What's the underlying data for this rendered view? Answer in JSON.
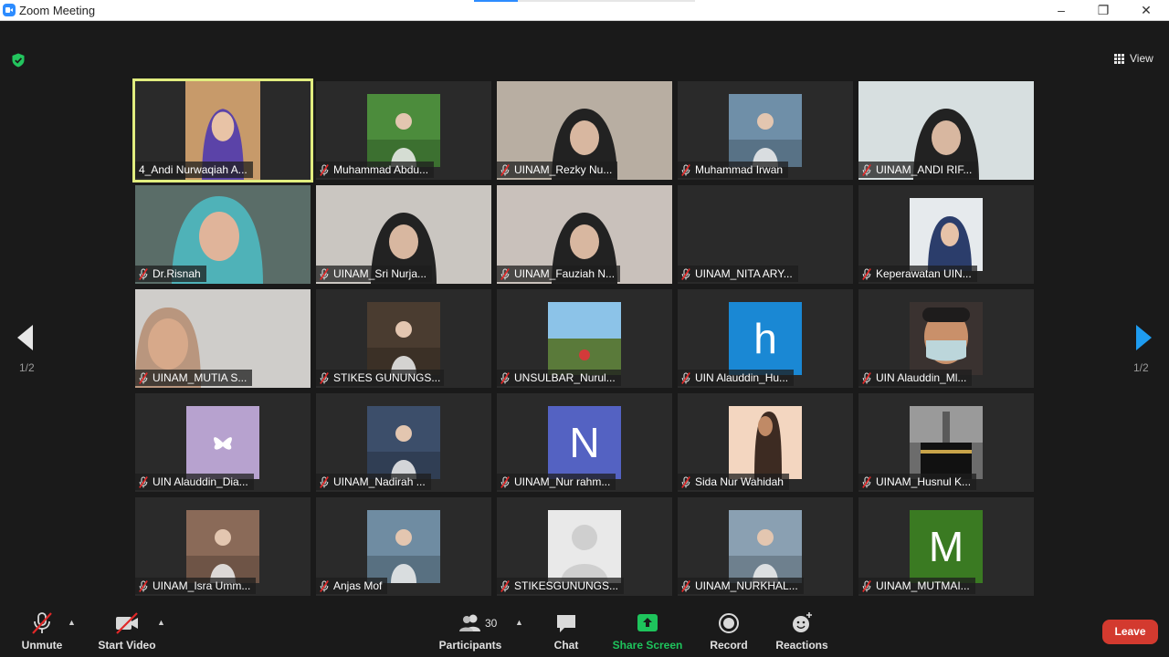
{
  "window": {
    "title": "Zoom Meeting",
    "minimize": "–",
    "restore": "❐",
    "close": "✕"
  },
  "header": {
    "view_label": "View"
  },
  "pagination": {
    "left": "1/2",
    "right": "1/2"
  },
  "participants": [
    {
      "name": "4_Andi Nurwaqiah A...",
      "muted": false,
      "active": true,
      "bg": "#c49a6c",
      "thumb": "person-hijab-purple"
    },
    {
      "name": "Muhammad Abdu...",
      "muted": true,
      "bg": "#4c8c3c",
      "thumb": "person-outdoor"
    },
    {
      "name": "UINAM_Rezky Nu...",
      "muted": true,
      "bg": "#b8aea2",
      "thumb": "person-hijab-dark"
    },
    {
      "name": "Muhammad Irwan",
      "muted": true,
      "bg": "#6f8fa8",
      "thumb": "person-shirt"
    },
    {
      "name": "UINAM_ANDI RIF...",
      "muted": true,
      "bg": "#d7dfe0",
      "thumb": "person-hijab-black"
    },
    {
      "name": "Dr.Risnah",
      "muted": true,
      "bg": "#5a6d68",
      "thumb": "person-hijab-teal"
    },
    {
      "name": "UINAM_Sri Nurja...",
      "muted": true,
      "bg": "#cac6c1",
      "thumb": "person-hijab-black"
    },
    {
      "name": "UINAM_Fauziah N...",
      "muted": true,
      "bg": "#c9c1bb",
      "thumb": "person-hijab-black"
    },
    {
      "name": "UINAM_NITA ARY...",
      "muted": true,
      "bg": "#2a2a2a",
      "thumb": "none"
    },
    {
      "name": "Keperawatan UIN...",
      "muted": true,
      "bg": "#e6eaed",
      "thumb": "person-hijab-navy"
    },
    {
      "name": "UINAM_MUTIA S...",
      "muted": true,
      "bg": "#cfcdca",
      "thumb": "person-face"
    },
    {
      "name": "STIKES GUNUNGS...",
      "muted": true,
      "bg": "#4a3c30",
      "thumb": "person-night"
    },
    {
      "name": "UNSULBAR_Nurul...",
      "muted": true,
      "bg": "#5a9ec8",
      "thumb": "landscape"
    },
    {
      "name": "UIN Alauddin_Hu...",
      "muted": true,
      "bg": "#1a88d4",
      "thumb": "letter",
      "letter": "h"
    },
    {
      "name": "UIN Alauddin_Ml...",
      "muted": true,
      "bg": "#3a3230",
      "thumb": "person-mask"
    },
    {
      "name": "UIN Alauddin_Dia...",
      "muted": true,
      "bg": "#b7a2cf",
      "thumb": "butterfly"
    },
    {
      "name": "UINAM_Nadirah ...",
      "muted": true,
      "bg": "#3c4e6a",
      "thumb": "person-white-hijab"
    },
    {
      "name": "UINAM_Nur rahm...",
      "muted": true,
      "bg": "#5462c2",
      "thumb": "letter",
      "letter": "N"
    },
    {
      "name": "Sida Nur Wahidah",
      "muted": true,
      "bg": "#f3d6c0",
      "thumb": "illustration"
    },
    {
      "name": "UINAM_Husnul K...",
      "muted": true,
      "bg": "#6c6c6c",
      "thumb": "kaaba"
    },
    {
      "name": "UINAM_Isra Umm...",
      "muted": true,
      "bg": "#8a6a58",
      "thumb": "person-white-hijab"
    },
    {
      "name": "Anjas Mof",
      "muted": true,
      "bg": "#6f8ca2",
      "thumb": "person-sea"
    },
    {
      "name": "STIKESGUNUNGS...",
      "muted": true,
      "bg": "#e9e9e9",
      "thumb": "avatar-default"
    },
    {
      "name": "UINAM_NURKHAL...",
      "muted": true,
      "bg": "#8aa0b2",
      "thumb": "person-building"
    },
    {
      "name": "UINAM_MUTMAI...",
      "muted": true,
      "bg": "#3a7a22",
      "thumb": "letter",
      "letter": "M"
    }
  ],
  "toolbar": {
    "unmute": "Unmute",
    "start_video": "Start Video",
    "participants": "Participants",
    "participants_count": "30",
    "chat": "Chat",
    "share_screen": "Share Screen",
    "record": "Record",
    "reactions": "Reactions",
    "leave": "Leave"
  },
  "colors": {
    "accent": "#2d8cff",
    "active_speaker": "#e1ed7f",
    "leave": "#d33a2f",
    "share": "#1ec45c",
    "muted_red": "#e02828"
  }
}
